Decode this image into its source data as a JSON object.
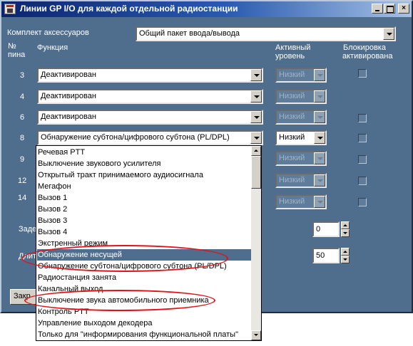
{
  "window": {
    "title": "Линии GP I/O для каждой отдельной радиостанции",
    "minimize_label": "",
    "maximize_label": "",
    "close_label": "×"
  },
  "accessory": {
    "label": "Комплект аксессуаров",
    "value": "Общий пакет ввода/вывода"
  },
  "headers": {
    "pin_no": "№",
    "pin": "пина",
    "function": "Функция",
    "active1": "Активный",
    "active2": "уровень",
    "lock1": "Блокировка",
    "lock2": "активирована"
  },
  "rows": [
    {
      "pin": "3",
      "function": "Деактивирован",
      "level": "Низкий",
      "level_enabled": false
    },
    {
      "pin": "4",
      "function": "Деактивирован",
      "level": "Низкий",
      "level_enabled": false
    },
    {
      "pin": "6",
      "function": "Деактивирован",
      "level": "Низкий",
      "level_enabled": false
    },
    {
      "pin": "8",
      "function": "Обнаружение субтона/цифрового субтона (PL/DPL)",
      "level": "Низкий",
      "level_enabled": true
    },
    {
      "pin": "9",
      "level": "Низкий",
      "level_enabled": false
    },
    {
      "pin": "12",
      "level": "Низкий",
      "level_enabled": false
    },
    {
      "pin": "14",
      "level": "Низкий",
      "level_enabled": false
    }
  ],
  "partial_labels": {
    "delay": "Заде",
    "duration": "Длит",
    "close_button": "Закр"
  },
  "spinners": {
    "first": "0",
    "second": "50"
  },
  "dropdown_items": [
    "Речевая PTT",
    "Выключение звукового усилителя",
    "Открытый тракт принимаемого аудиосигнала",
    "Мегафон",
    "Вызов 1",
    "Вызов 2",
    "Вызов 3",
    "Вызов 4",
    "Экстренный режим",
    "Обнаружение несущей",
    "Обнаружение субтона/цифрового субтона (PL/DPL)",
    "Радиостанция занята",
    "Канальный выход",
    "Выключение звука автомобильного приемника",
    "Контроль PTT",
    "Управление выходом декодера",
    "Только для \"информирования функциональной платы\""
  ],
  "selected_index": 9,
  "colors": {
    "dialog_bg": "#4f6e8e",
    "title_start": "#0b2470",
    "title_end": "#a6c1e6",
    "highlight": "#4f6e8e",
    "annotation": "#e0121a"
  }
}
